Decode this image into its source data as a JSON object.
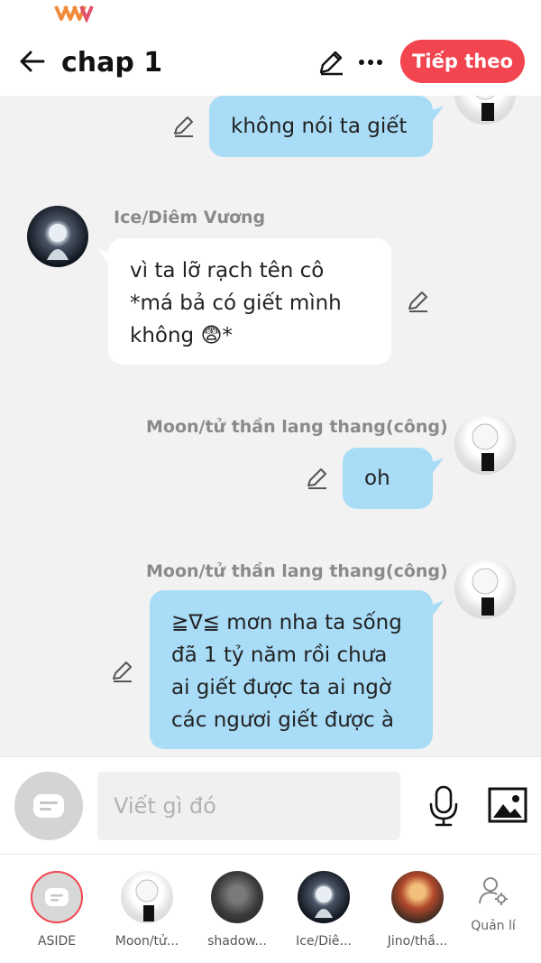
{
  "header": {
    "title": "chap 1",
    "next_label": "Tiếp theo"
  },
  "messages": [
    {
      "sender": "",
      "side": "right",
      "text": "không nói ta giết"
    },
    {
      "sender": "Ice/Diêm Vương",
      "side": "left",
      "lines": [
        "vì ta lỡ rạch tên cô",
        "*má bả có giết mình",
        "không 😨*"
      ]
    },
    {
      "sender": "Moon/tử thần lang thang(công)",
      "side": "right",
      "text": "oh"
    },
    {
      "sender": "Moon/tử thần lang thang(công)",
      "side": "right",
      "lines": [
        "≧∇≦ mơn nha ta sống",
        "đã 1 tỷ năm rồi chưa",
        "ai giết được ta ai ngờ",
        "các ngươi giết được à"
      ]
    }
  ],
  "composer": {
    "placeholder": "Viết gì đó"
  },
  "characters": [
    {
      "label": "ASIDE"
    },
    {
      "label": "Moon/tử..."
    },
    {
      "label": "shadow..."
    },
    {
      "label": "Ice/Diê..."
    },
    {
      "label": "Jino/thầ..."
    }
  ],
  "manage_label": "Quản lí",
  "colors": {
    "accent": "#f2454f",
    "bubble_blue": "#a9dcf7",
    "background": "#f2f2f2"
  },
  "icons": [
    "back-arrow-icon",
    "pencil-icon",
    "more-icon",
    "mic-icon",
    "image-icon",
    "aside-chat-icon",
    "manage-user-icon"
  ]
}
